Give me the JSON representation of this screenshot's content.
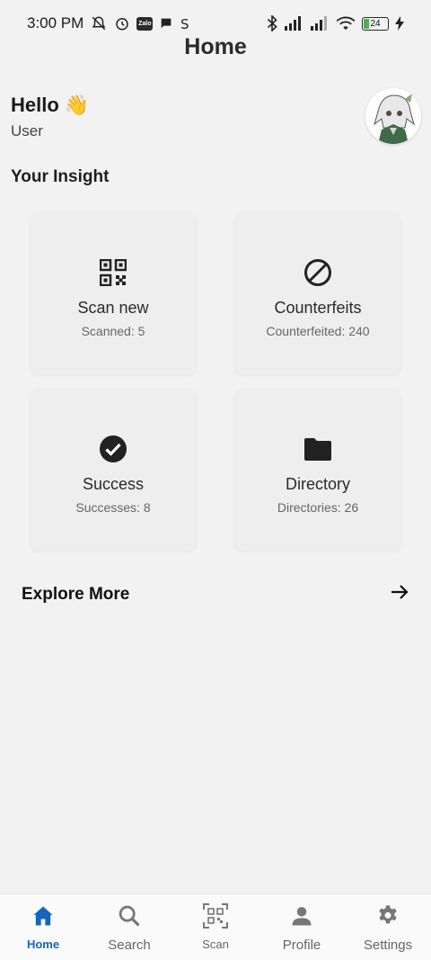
{
  "status_bar": {
    "time": "3:00 PM",
    "zalo": "Zalo",
    "battery": "24"
  },
  "header": {
    "title": "Home"
  },
  "greeting": {
    "hello": "Hello",
    "emoji": "👋",
    "user": "User"
  },
  "insight": {
    "title": "Your Insight",
    "cards": [
      {
        "title": "Scan new",
        "subtitle": "Scanned: 5",
        "icon": "qr-code-icon"
      },
      {
        "title": "Counterfeits",
        "subtitle": "Counterfeited: 240",
        "icon": "block-icon"
      },
      {
        "title": "Success",
        "subtitle": "Successes: 8",
        "icon": "check-circle-icon"
      },
      {
        "title": "Directory",
        "subtitle": "Directories: 26",
        "icon": "folder-icon"
      }
    ]
  },
  "explore": {
    "label": "Explore More"
  },
  "nav": {
    "items": [
      {
        "label": "Home",
        "icon": "home-icon",
        "active": true
      },
      {
        "label": "Search",
        "icon": "search-icon"
      },
      {
        "label": "Scan",
        "icon": "qr-scan-icon"
      },
      {
        "label": "Profile",
        "icon": "person-icon"
      },
      {
        "label": "Settings",
        "icon": "gear-icon"
      }
    ]
  },
  "colors": {
    "accent": "#1565c0",
    "background": "#f2f2f2",
    "card": "#eeeeee"
  }
}
